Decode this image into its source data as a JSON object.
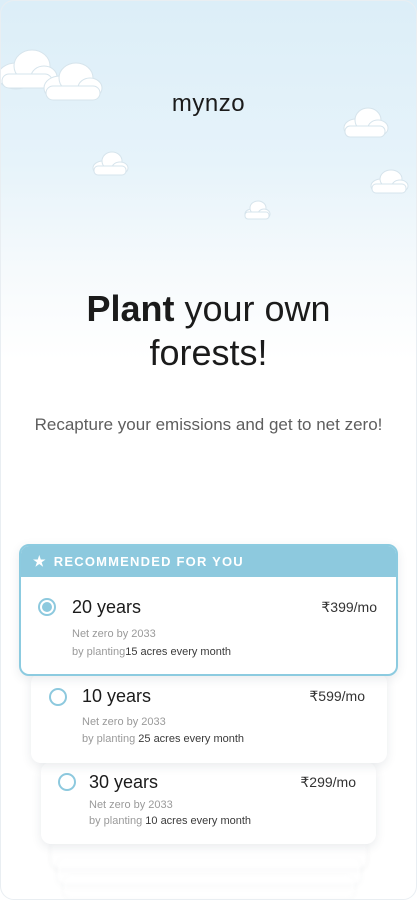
{
  "brand": {
    "logo": "mynzo"
  },
  "hero": {
    "title_bold": "Plant",
    "title_rest_line1": " your own",
    "title_line2": "forests!",
    "subtitle": "Recapture your emissions and get to net zero!"
  },
  "recommended": {
    "banner": "RECOMMENDED FOR YOU",
    "icon": "star-icon"
  },
  "plans": [
    {
      "title": "20 years",
      "price": "₹399/mo",
      "net_zero": "Net zero by 2033",
      "planting_prefix": "by planting",
      "planting_value": "15 acres every month",
      "selected": true
    },
    {
      "title": "10 years",
      "price": "₹599/mo",
      "net_zero": "Net zero by 2033",
      "planting_prefix": "by planting",
      "planting_value": " 25 acres every month",
      "selected": false
    },
    {
      "title": "30 years",
      "price": "₹299/mo",
      "net_zero": "Net zero by 2033",
      "planting_prefix": "by planting",
      "planting_value": " 10 acres every month",
      "selected": false
    }
  ],
  "colors": {
    "accent": "#8dc9de",
    "sky": "#dceef8"
  }
}
